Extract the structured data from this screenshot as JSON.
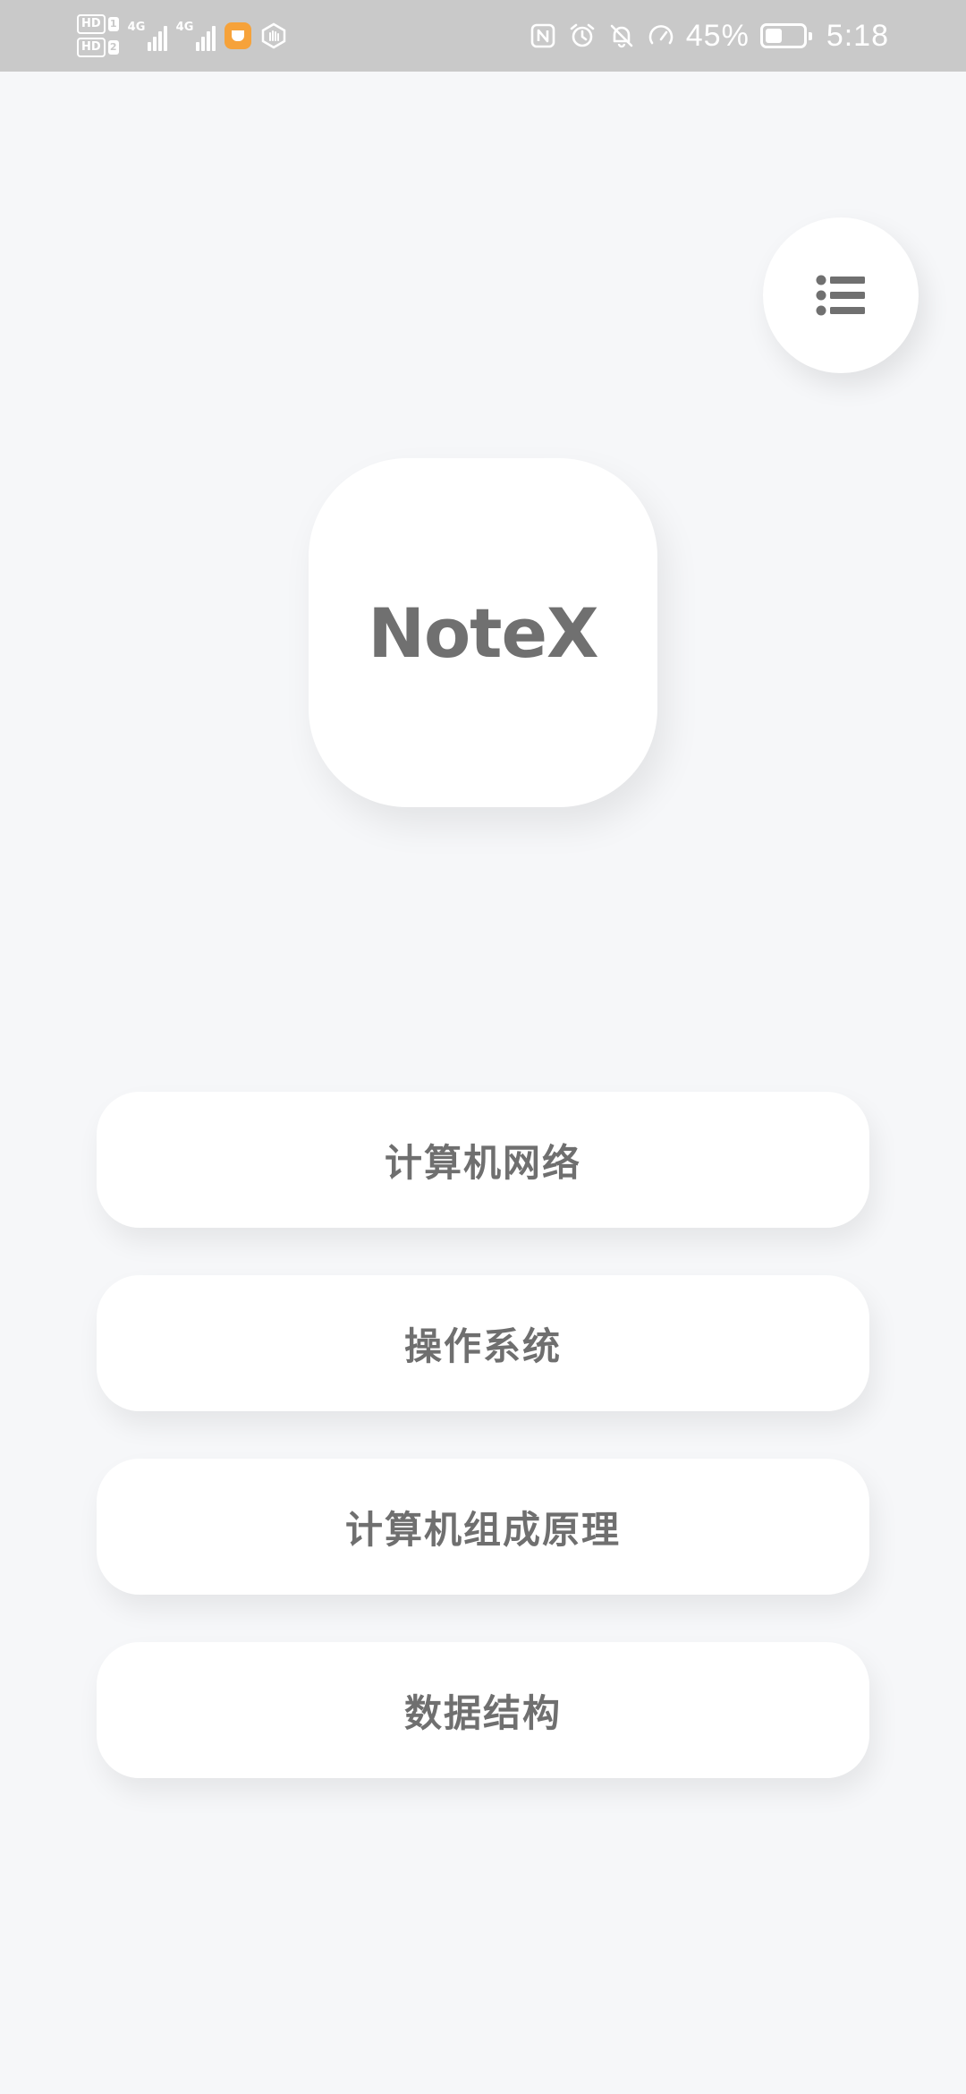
{
  "status_bar": {
    "sim1": "HD",
    "sim1_index": "1",
    "sim2": "HD",
    "sim2_index": "2",
    "network1": "4G",
    "network2": "4G",
    "icons": [
      "nfc-icon",
      "alarm-icon",
      "mute-icon",
      "speed-icon"
    ],
    "battery_percent_label": "45%",
    "battery_level": 0.45,
    "time": "5:18"
  },
  "app": {
    "logo_text": "NoteX"
  },
  "menu": {
    "icon": "list-icon"
  },
  "topics": [
    {
      "label": "计算机网络"
    },
    {
      "label": "操作系统"
    },
    {
      "label": "计算机组成原理"
    },
    {
      "label": "数据结构"
    }
  ],
  "colors": {
    "background": "#f6f7f9",
    "card": "#ffffff",
    "text": "#6f6f6f",
    "status_bar": "#c9c9c9"
  }
}
